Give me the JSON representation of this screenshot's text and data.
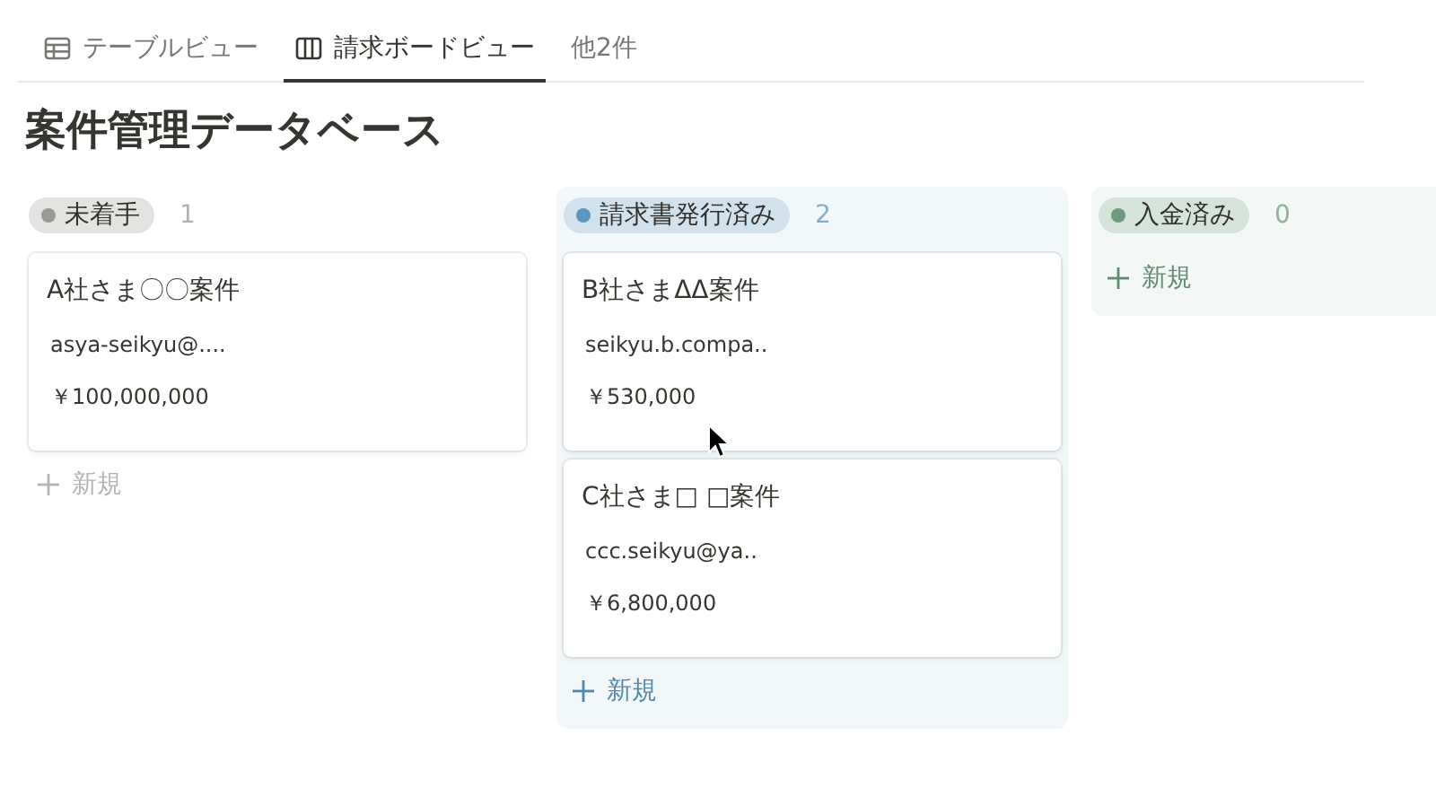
{
  "tabs": [
    {
      "label": "テーブルビュー",
      "kind": "table",
      "selected": false
    },
    {
      "label": "請求ボードビュー",
      "kind": "board",
      "selected": true
    },
    {
      "label": "他2件",
      "kind": "more",
      "selected": false
    }
  ],
  "title": "案件管理データベース",
  "columns": [
    {
      "status": "未着手",
      "count": "1",
      "color": "#9b9a97",
      "new_label": "新規",
      "cards": [
        {
          "title": "A社さま〇〇案件",
          "email": "asya-seikyu@....",
          "amount": "￥100,000,000"
        }
      ]
    },
    {
      "status": "請求書発行済み",
      "count": "2",
      "color": "#5b97bd",
      "new_label": "新規",
      "cards": [
        {
          "title": "B社さまΔΔ案件",
          "email": "seikyu.b.compa..",
          "amount": "￥530,000"
        },
        {
          "title": "C社さま□ □案件",
          "email": "ccc.seikyu@ya..",
          "amount": "￥6,800,000"
        }
      ]
    },
    {
      "status": "入金済み",
      "count": "0",
      "color": "#6c9b7d",
      "new_label": "新規"
    }
  ]
}
